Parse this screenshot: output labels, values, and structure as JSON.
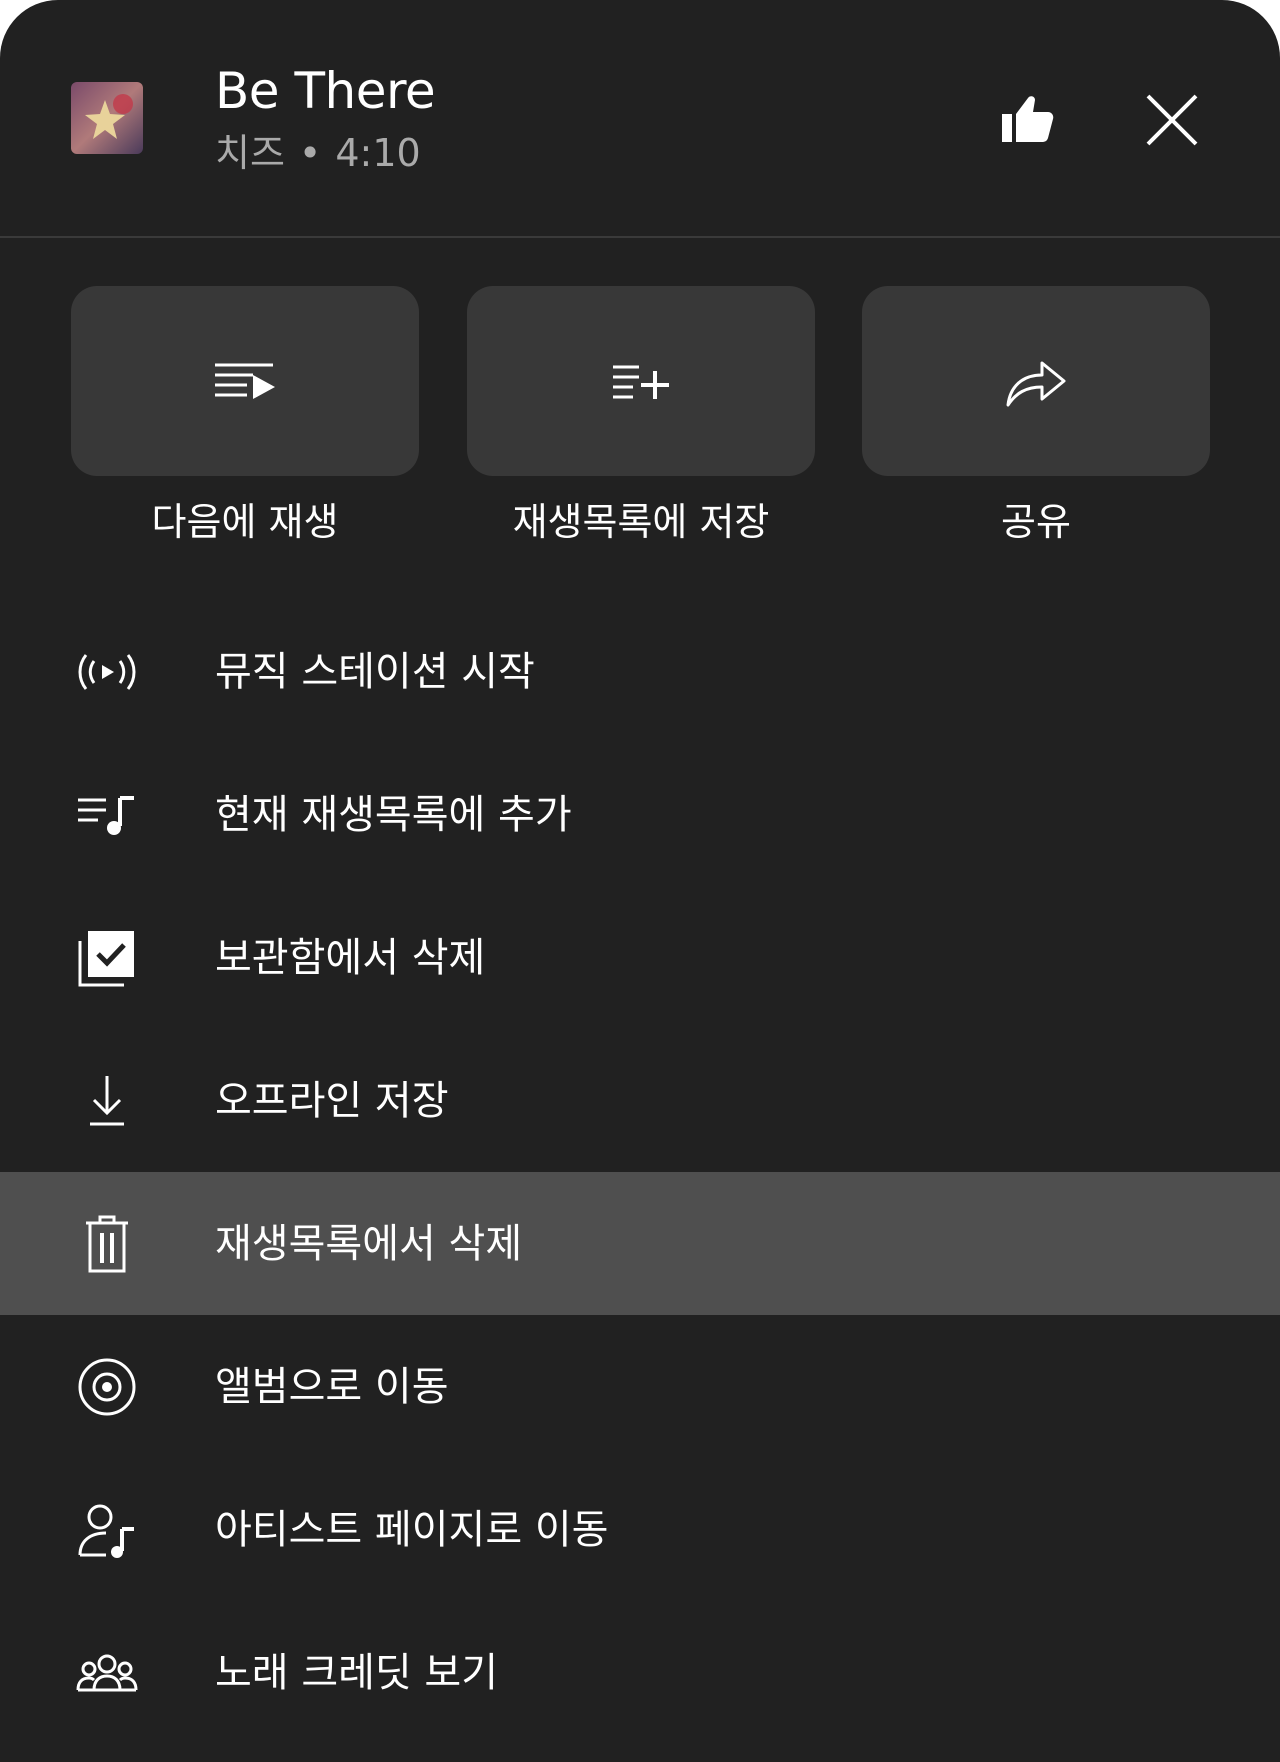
{
  "header": {
    "title": "Be There",
    "artist": "치즈",
    "separator": "•",
    "duration": "4:10"
  },
  "quick_actions": [
    {
      "label": "다음에 재생",
      "icon": "play-next-icon"
    },
    {
      "label": "재생목록에 저장",
      "icon": "playlist-add-icon"
    },
    {
      "label": "공유",
      "icon": "share-icon"
    }
  ],
  "menu": {
    "items": [
      {
        "label": "뮤직 스테이션 시작",
        "icon": "radio-icon"
      },
      {
        "label": "현재 재생목록에 추가",
        "icon": "queue-music-icon"
      },
      {
        "label": "보관함에서 삭제",
        "icon": "library-remove-icon"
      },
      {
        "label": "오프라인 저장",
        "icon": "download-icon"
      },
      {
        "label": "재생목록에서 삭제",
        "icon": "trash-icon"
      },
      {
        "label": "앨범으로 이동",
        "icon": "album-icon"
      },
      {
        "label": "아티스트 페이지로 이동",
        "icon": "artist-icon"
      },
      {
        "label": "노래 크레딧 보기",
        "icon": "people-icon"
      }
    ],
    "highlighted_index": 4
  },
  "colors": {
    "sheet_background": "#212121",
    "tile_background": "#383838",
    "highlight_background": "#4f4f4f",
    "text_primary": "#ffffff",
    "text_secondary": "#aaaaaa"
  }
}
